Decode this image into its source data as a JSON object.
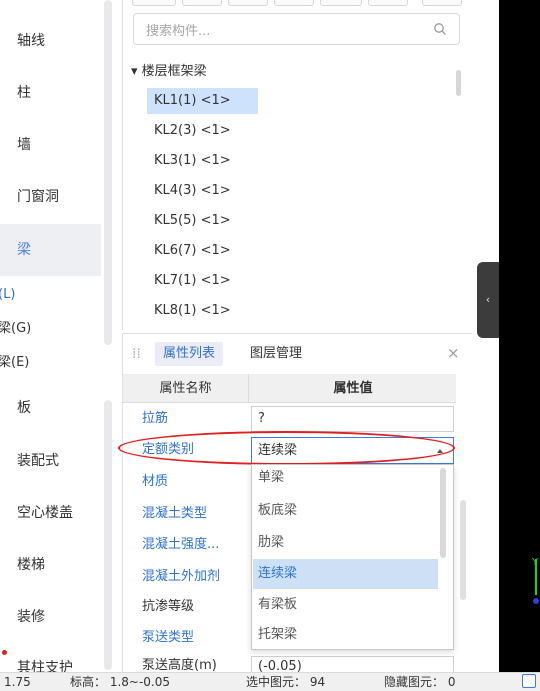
{
  "left_nav": {
    "items": [
      {
        "label": "轴线"
      },
      {
        "label": "柱"
      },
      {
        "label": "墙"
      },
      {
        "label": "门窗洞"
      },
      {
        "label": "梁"
      },
      {
        "label": "板"
      },
      {
        "label": "装配式"
      },
      {
        "label": "空心楼盖"
      },
      {
        "label": "楼梯"
      },
      {
        "label": "装修"
      },
      {
        "label": "其柱支护"
      }
    ],
    "sub_items": [
      {
        "label": "(L)"
      },
      {
        "label": "梁(G)"
      },
      {
        "label": "梁(E)"
      }
    ]
  },
  "component_tree": {
    "search_placeholder": "搜索构件...",
    "root_label": "▾ 楼层框架梁",
    "items": [
      {
        "label": "KL1(1) <1>",
        "selected": true
      },
      {
        "label": "KL2(3) <1>"
      },
      {
        "label": "KL3(1) <1>"
      },
      {
        "label": "KL4(3) <1>"
      },
      {
        "label": "KL5(5) <1>"
      },
      {
        "label": "KL6(7) <1>"
      },
      {
        "label": "KL7(1) <1>"
      },
      {
        "label": "KL8(1) <1>"
      }
    ]
  },
  "collapse_handle": {
    "glyph": "‹"
  },
  "property_panel": {
    "grip": "⁞⁞",
    "tabs": [
      {
        "label": "属性列表",
        "active": true
      },
      {
        "label": "图层管理"
      }
    ],
    "close_glyph": "×",
    "header": {
      "name": "属性名称",
      "value": "属性值"
    },
    "rows": [
      {
        "name": "拉筋",
        "value": "?",
        "link": true
      },
      {
        "name": "定额类别",
        "value": "连续梁",
        "link": true
      },
      {
        "name": "材质",
        "link": true
      },
      {
        "name": "混凝土类型",
        "link": true
      },
      {
        "name": "混凝土强度...",
        "link": true
      },
      {
        "name": "混凝土外加剂",
        "link": true
      },
      {
        "name": "抗渗等级",
        "link": false
      },
      {
        "name": "泵送类型",
        "link": true
      },
      {
        "name": "泵送高度(m)",
        "value": "(-0.05)",
        "link": false
      }
    ],
    "dropdown_options": [
      {
        "label": "单梁"
      },
      {
        "label": "板底梁"
      },
      {
        "label": "肋梁"
      },
      {
        "label": "连续梁",
        "selected": true
      },
      {
        "label": "有梁板"
      },
      {
        "label": "托架梁"
      }
    ]
  },
  "status_bar": {
    "item1": "1.75",
    "item2": "标高：  1.8~-0.05",
    "item3": "选中图元：  94",
    "item4": "隐藏图元：  0"
  },
  "colors": {
    "accent": "#2f74d3",
    "highlight": "#e02020",
    "selected_bg": "#cfe2fb",
    "viewport_bg": "#000000"
  }
}
